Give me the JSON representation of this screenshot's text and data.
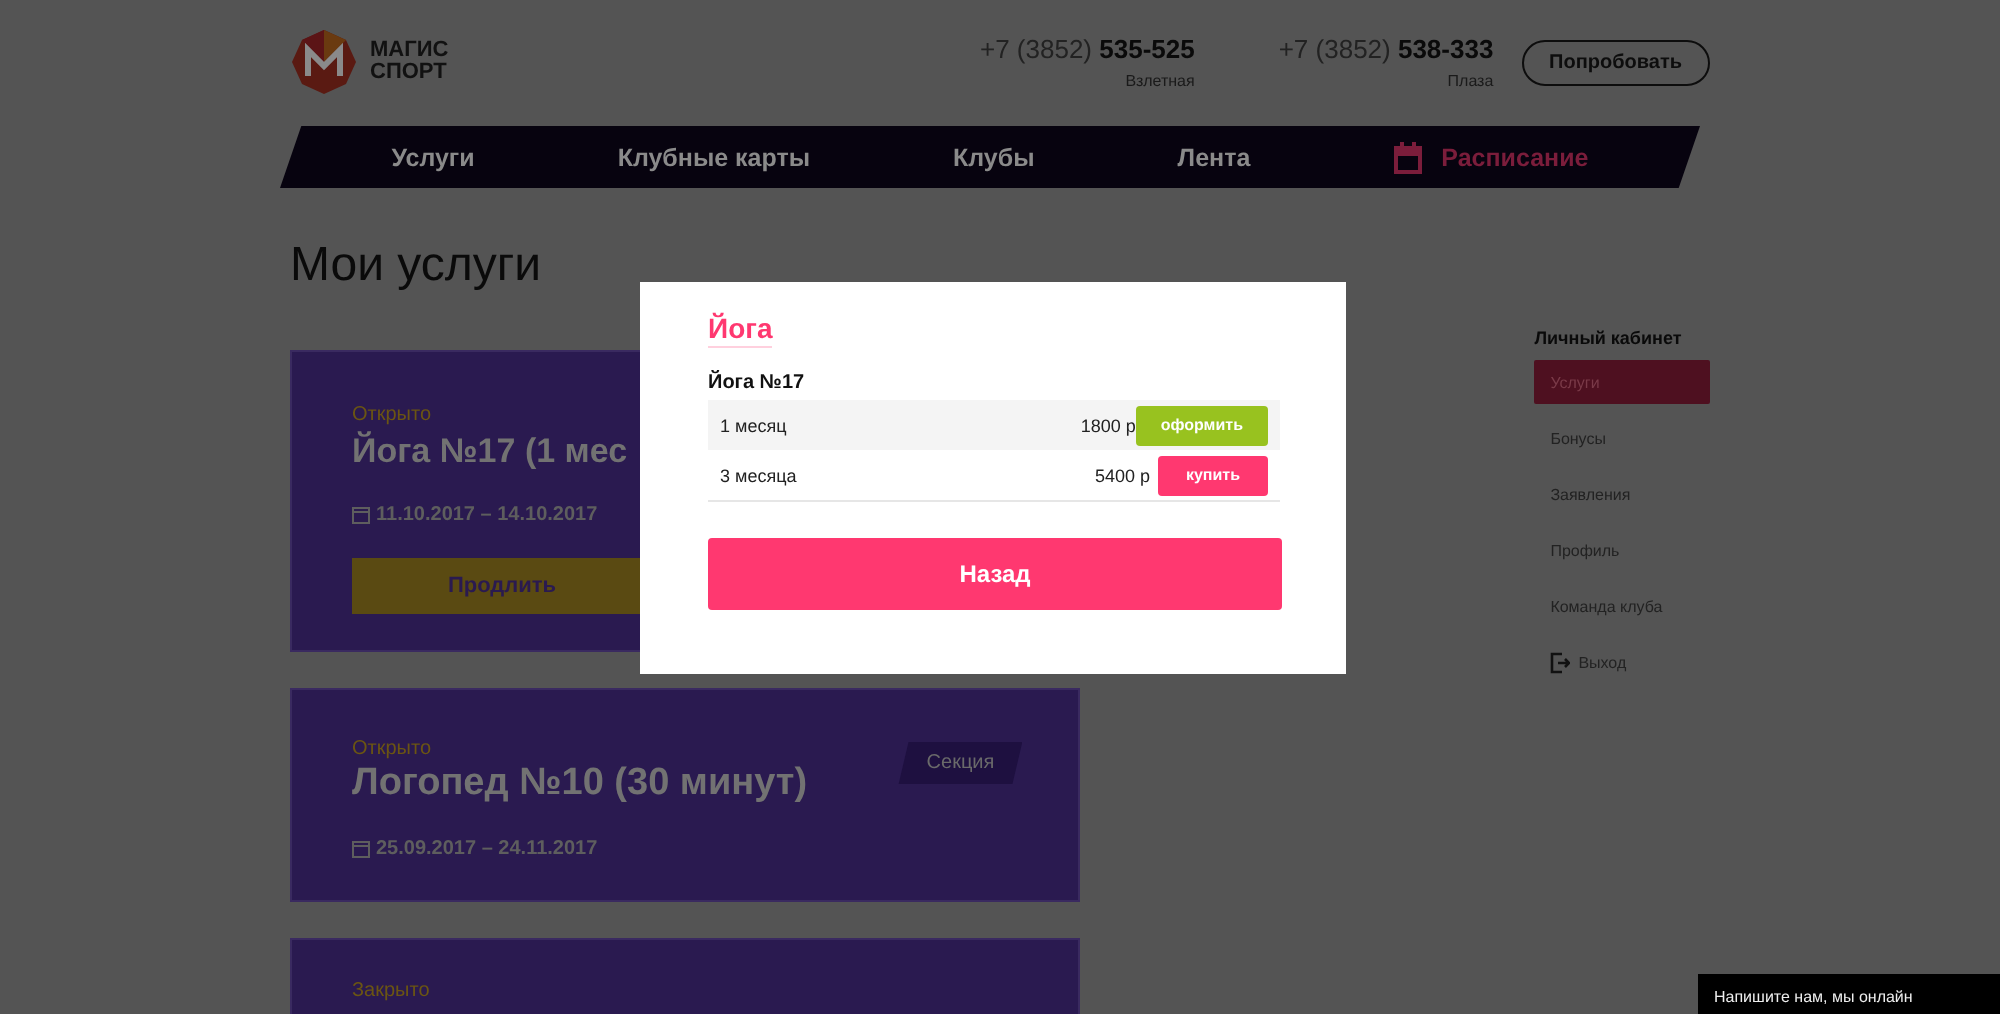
{
  "header": {
    "logo": {
      "line_1": "МАГИС",
      "line_2": "СПОРТ"
    },
    "phones": [
      {
        "prefix": "+7 (3852)",
        "number": "535-525",
        "place": "Взлетная"
      },
      {
        "prefix": "+7 (3852)",
        "number": "538-333",
        "place": "Плаза"
      }
    ],
    "try_button": "Попробовать"
  },
  "nav": [
    {
      "label": "Услуги",
      "kind": "plain"
    },
    {
      "label": "Клубные карты",
      "kind": "plain"
    },
    {
      "label": "Клубы",
      "kind": "plain"
    },
    {
      "label": "Лента",
      "kind": "plain"
    },
    {
      "label": "Расписание",
      "kind": "accent"
    }
  ],
  "page_title": "Мои услуги",
  "services": [
    {
      "status": "Открыто",
      "title": "Йога №17 (1 мес",
      "dates": "11.10.2017 – 14.10.2017",
      "button": "Продлить"
    },
    {
      "status": "Открыто",
      "title": "Логопед №10 (30 минут)",
      "dates": "25.09.2017 – 24.11.2017",
      "badge": "Секция"
    },
    {
      "status": "Закрыто"
    }
  ],
  "sidebar": {
    "title": "Личный кабинет",
    "items": [
      {
        "label": "Услуги",
        "selected": true,
        "kind": "link"
      },
      {
        "label": "Бонусы",
        "selected": false,
        "kind": "link"
      },
      {
        "label": "Заявления",
        "selected": false,
        "kind": "link"
      },
      {
        "label": "Профиль",
        "selected": false,
        "kind": "link"
      },
      {
        "label": "Команда клуба",
        "selected": false,
        "kind": "link"
      },
      {
        "label": "Выход",
        "selected": false,
        "kind": "exit"
      }
    ]
  },
  "modal": {
    "title": "Йога",
    "subtitle": "Йога №17",
    "rows": [
      {
        "period": "1 месяц",
        "price": "1800 р",
        "action": {
          "label": "оформить",
          "kind": "order"
        }
      },
      {
        "period": "3 месяца",
        "price": "5400 р",
        "action": {
          "label": "купить",
          "kind": "buy"
        }
      }
    ],
    "back_button": "Назад"
  },
  "chat": {
    "label": "Напишите нам, мы онлайн"
  }
}
